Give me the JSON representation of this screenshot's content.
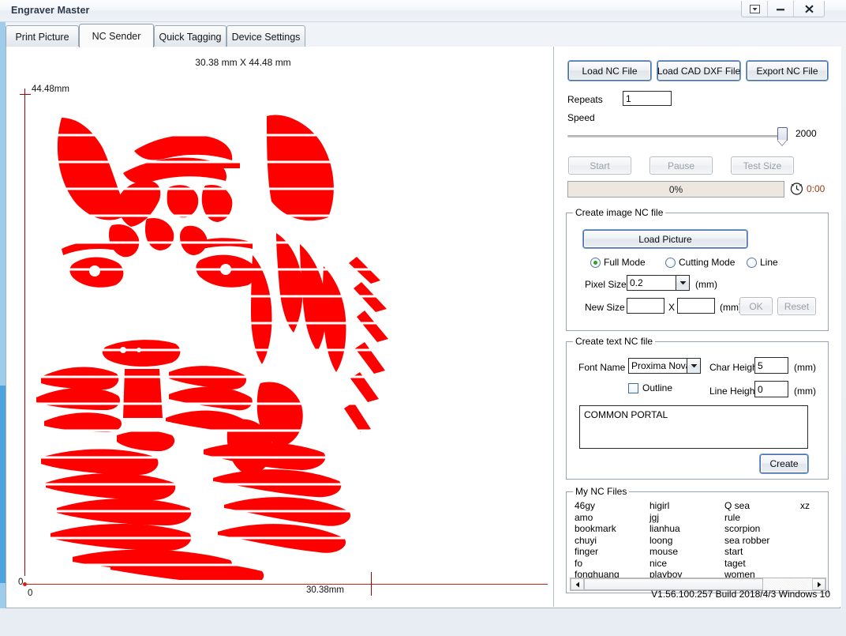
{
  "window": {
    "title": "Engraver Master",
    "controls": [
      {
        "name": "restore-dropdown",
        "glyph": "▼"
      },
      {
        "name": "minimize",
        "glyph": "–"
      },
      {
        "name": "close",
        "glyph": "✕"
      }
    ]
  },
  "tabs": [
    {
      "label": "Print Picture",
      "active": false
    },
    {
      "label": "NC Sender",
      "active": true
    },
    {
      "label": "Quick Tagging",
      "active": false
    },
    {
      "label": "Device Settings",
      "active": false
    }
  ],
  "canvas": {
    "dimension_label": "30.38 mm X 44.48 mm",
    "y_max_label": "44.48mm",
    "x_max_label": "30.38mm",
    "origin_y_label": "0",
    "origin_x_label": "0",
    "artwork_color": "#FF0000",
    "artwork_name": "tiger-stencil"
  },
  "toolbar": {
    "load_nc_file": "Load NC File",
    "load_cad_dxf_file": "Load CAD DXF File",
    "export_nc_file": "Export NC File"
  },
  "job": {
    "repeats_label": "Repeats",
    "repeats_value": "1",
    "speed_label": "Speed",
    "speed_value": "2000",
    "start_label": "Start",
    "pause_label": "Pause",
    "test_size_label": "Test Size",
    "progress_text": "0%",
    "elapsed_time": "0:00"
  },
  "image_nc": {
    "group_title": "Create image NC file",
    "load_picture": "Load Picture",
    "modes": [
      {
        "label": "Full Mode",
        "selected": true
      },
      {
        "label": "Cutting Mode",
        "selected": false
      },
      {
        "label": "Line",
        "selected": false
      }
    ],
    "pixel_size_label": "Pixel Size",
    "pixel_size_value": "0.2",
    "pixel_size_unit": "(mm)",
    "new_size_label": "New Size",
    "new_size_w": "",
    "new_size_h": "",
    "new_size_sep": "X",
    "new_size_unit": "(mm)",
    "ok_label": "OK",
    "reset_label": "Reset"
  },
  "text_nc": {
    "group_title": "Create text NC file",
    "font_name_label": "Font Name",
    "font_name_value": "Proxima Nova",
    "outline_label": "Outline",
    "char_height_label": "Char Height",
    "char_height_value": "5",
    "char_height_unit": "(mm)",
    "line_height_label": "Line Height",
    "line_height_value": "0",
    "line_height_unit": "(mm)",
    "text_value": "COMMON PORTAL",
    "create_label": "Create"
  },
  "my_nc_files": {
    "group_title": "My NC Files",
    "columns": [
      [
        "46gy",
        "amo",
        "bookmark",
        "chuyi",
        "finger",
        "fo",
        "fonghuang"
      ],
      [
        "higirl",
        "jgj",
        "lianhua",
        "loong",
        "mouse",
        "nice",
        "playboy"
      ],
      [
        "Q sea",
        "rule",
        "scorpion",
        "sea robber",
        "start",
        "taget",
        "women"
      ],
      [
        "xz"
      ]
    ]
  },
  "statusbar": {
    "version": "V1.56.100.257 Build 2018/4/3 Windows 10"
  }
}
